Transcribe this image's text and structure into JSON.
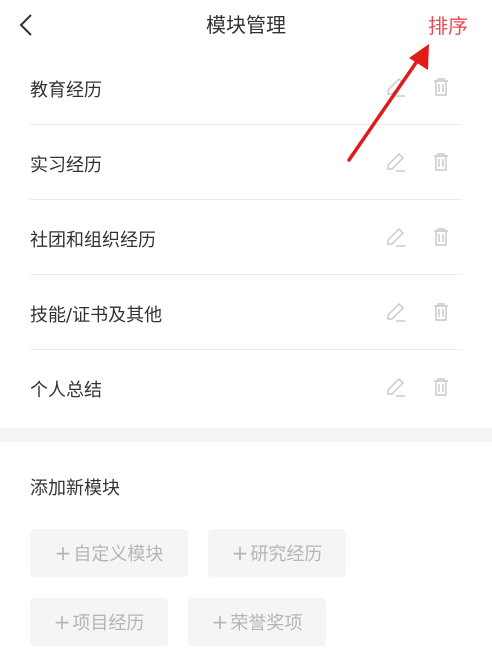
{
  "header": {
    "title": "模块管理",
    "sort_label": "排序",
    "accent_color": "#e84c52"
  },
  "modules": [
    {
      "label": "教育经历",
      "edit_icon": "pencil-icon",
      "delete_icon": "trash-icon"
    },
    {
      "label": "实习经历",
      "edit_icon": "pencil-icon",
      "delete_icon": "trash-icon"
    },
    {
      "label": "社团和组织经历",
      "edit_icon": "pencil-icon",
      "delete_icon": "trash-icon"
    },
    {
      "label": "技能/证书及其他",
      "edit_icon": "pencil-icon",
      "delete_icon": "trash-icon"
    },
    {
      "label": "个人总结",
      "edit_icon": "pencil-icon",
      "delete_icon": "trash-icon"
    }
  ],
  "add_section": {
    "title": "添加新模块",
    "options": [
      {
        "label": "自定义模块"
      },
      {
        "label": "研究经历"
      },
      {
        "label": "项目经历"
      },
      {
        "label": "荣誉奖项"
      }
    ]
  },
  "annotation": {
    "arrow_color": "#e11a1a"
  }
}
